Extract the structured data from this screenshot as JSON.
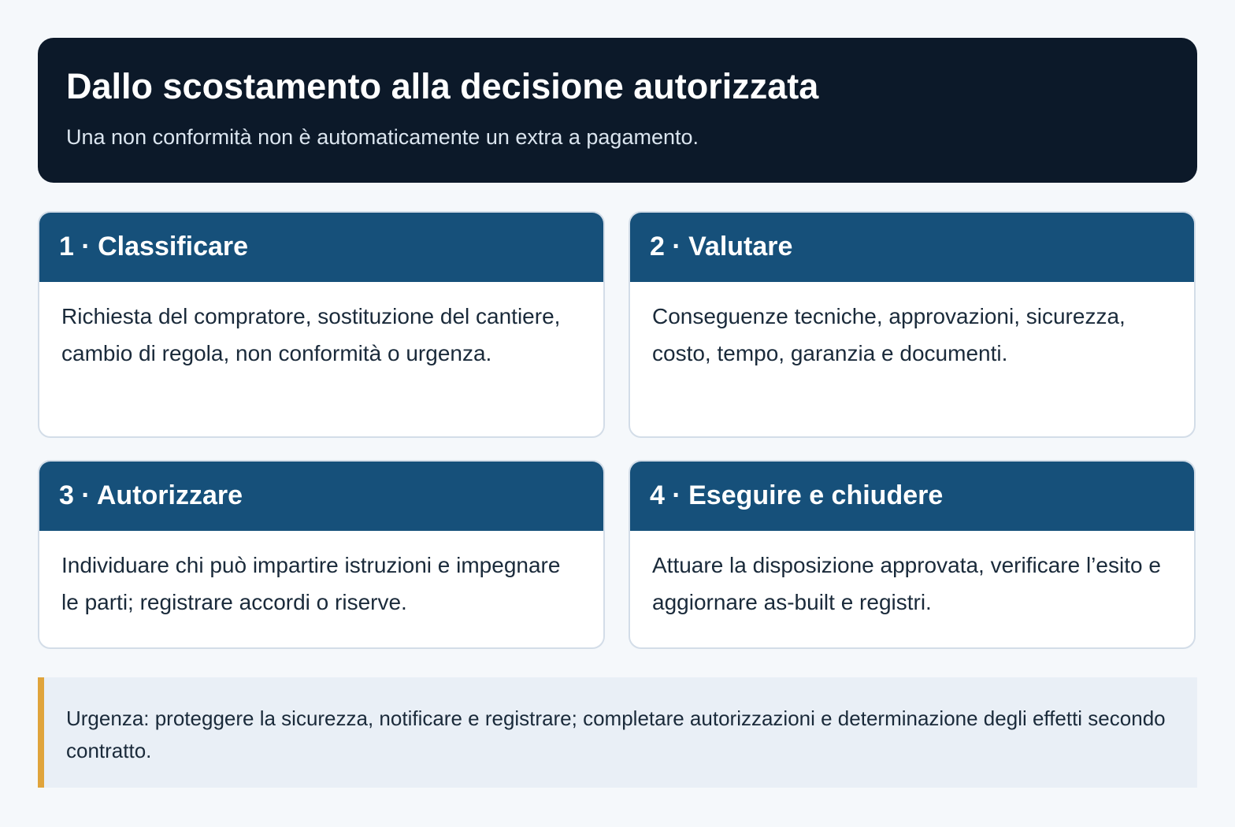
{
  "header": {
    "title": "Dallo scostamento alla decisione autorizzata",
    "subtitle": "Una non conformità non è automaticamente un extra a pagamento."
  },
  "steps": [
    {
      "title": "1 · Classificare",
      "text": "Richiesta del compratore, sostituzione del cantiere, cambio di regola, non conformità o urgenza."
    },
    {
      "title": "2 · Valutare",
      "text": "Conseguenze tecniche, approvazioni, sicurezza, costo, tempo, garanzia e documenti."
    },
    {
      "title": "3 · Autorizzare",
      "text": "Individuare chi può impartire istruzioni e impegnare le parti; registrare accordi o riserve."
    },
    {
      "title": "4 · Eseguire e chiudere",
      "text": "Attuare la disposizione approvata, verificare l’esito e aggiornare as-built e registri."
    }
  ],
  "note": {
    "text": "Urgenza: proteggere la sicurezza, notificare e registrare; completare autorizzazioni e determinazione degli effetti secondo contratto."
  },
  "colors": {
    "background": "#f5f8fb",
    "header_bg": "#0c1929",
    "card_header_bg": "#16507a",
    "note_accent": "#e0a43b",
    "note_bg": "#e9eff6"
  }
}
